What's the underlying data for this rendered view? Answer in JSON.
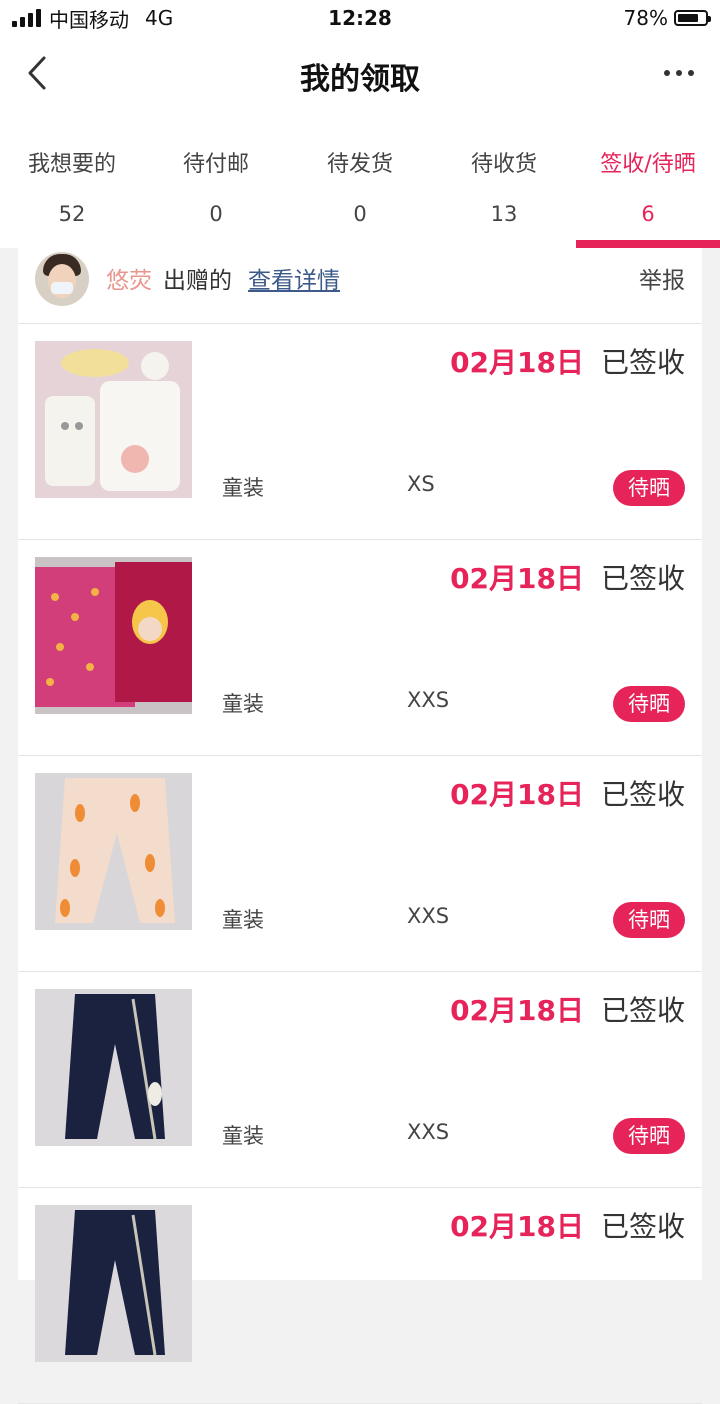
{
  "status_bar": {
    "carrier": "中国移动",
    "network": "4G",
    "time": "12:28",
    "battery": "78%",
    "battery_level": 0.78
  },
  "nav": {
    "title": "我的领取",
    "back_icon": "chevron-left-icon",
    "more_icon": "more-dots-icon"
  },
  "tabs": [
    {
      "label": "我想要的",
      "count": "52"
    },
    {
      "label": "待付邮",
      "count": "0"
    },
    {
      "label": "待发货",
      "count": "0"
    },
    {
      "label": "待收货",
      "count": "13"
    },
    {
      "label": "签收/待晒",
      "count": "6",
      "active": true
    }
  ],
  "giver": {
    "name": "悠荧",
    "suffix": "出赠的",
    "detail_link": "查看详情",
    "report": "举报"
  },
  "items": [
    {
      "date": "02月18日",
      "status": "已签收",
      "category": "童装",
      "size": "XS",
      "action": "待晒"
    },
    {
      "date": "02月18日",
      "status": "已签收",
      "category": "童装",
      "size": "XXS",
      "action": "待晒"
    },
    {
      "date": "02月18日",
      "status": "已签收",
      "category": "童装",
      "size": "XXS",
      "action": "待晒"
    },
    {
      "date": "02月18日",
      "status": "已签收",
      "category": "童装",
      "size": "XXS",
      "action": "待晒"
    },
    {
      "date": "02月18日",
      "status": "已签收"
    }
  ],
  "colors": {
    "accent": "#e6245a",
    "giver_name": "#e8968e",
    "link": "#3d5a8a"
  }
}
